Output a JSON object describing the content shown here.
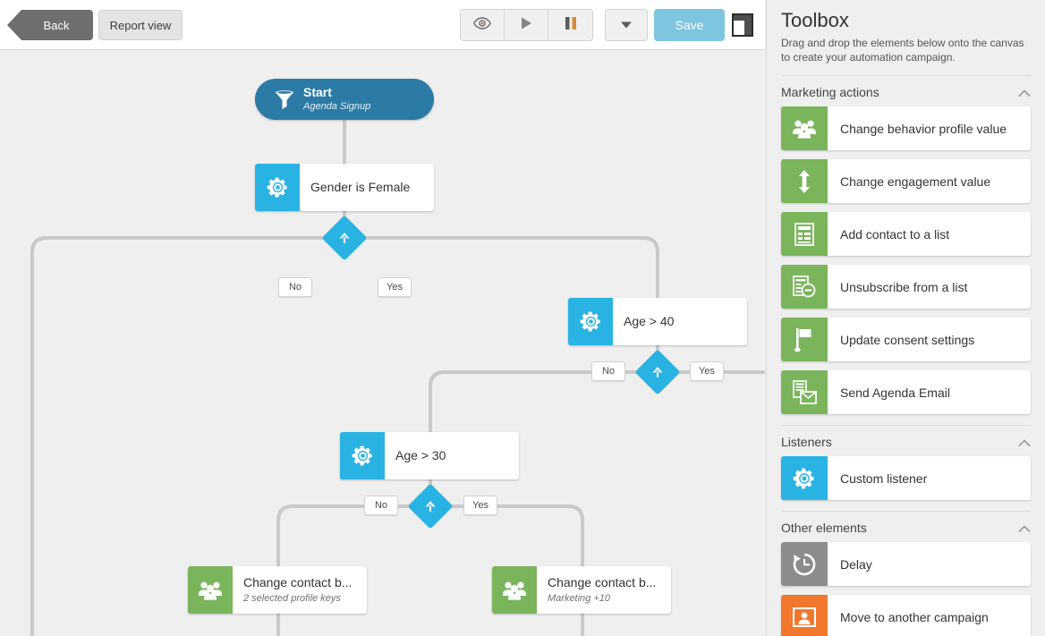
{
  "toolbar": {
    "back_label": "Back",
    "report_label": "Report view",
    "preview_icon": "eye-icon",
    "play_icon": "play-icon",
    "pause_icon": "pause-icon",
    "dropdown_icon": "chevron-down-icon",
    "save_label": "Save",
    "panel_toggle_icon": "panel-layout-icon"
  },
  "toolbox": {
    "title": "Toolbox",
    "description": "Drag and drop the elements below onto the canvas to create your automation campaign.",
    "sections": [
      {
        "label": "Marketing actions",
        "collapse_icon": "chevron-up-icon",
        "items": [
          {
            "label": "Change behavior profile value",
            "icon": "people-group-icon",
            "color": "green"
          },
          {
            "label": "Change engagement value",
            "icon": "up-down-arrow-icon",
            "color": "green"
          },
          {
            "label": "Add contact to a list",
            "icon": "list-document-icon",
            "color": "green"
          },
          {
            "label": "Unsubscribe from a list",
            "icon": "list-minus-icon",
            "color": "green"
          },
          {
            "label": "Update consent settings",
            "icon": "flag-icon",
            "color": "green"
          },
          {
            "label": "Send Agenda Email",
            "icon": "envelope-document-icon",
            "color": "green"
          }
        ]
      },
      {
        "label": "Listeners",
        "collapse_icon": "chevron-up-icon",
        "items": [
          {
            "label": "Custom listener",
            "icon": "gear-icon",
            "color": "blue"
          }
        ]
      },
      {
        "label": "Other elements",
        "collapse_icon": "chevron-up-icon",
        "items": [
          {
            "label": "Delay",
            "icon": "clock-rewind-icon",
            "color": "grey"
          },
          {
            "label": "Move to another campaign",
            "icon": "contact-portrait-icon",
            "color": "orange"
          }
        ]
      }
    ]
  },
  "canvas": {
    "start": {
      "title": "Start",
      "subtitle": "Agenda Signup",
      "icon": "funnel-icon"
    },
    "nodes": [
      {
        "title": "Gender is Female",
        "subtitle": "",
        "icon": "gear-icon",
        "color": "blue"
      },
      {
        "title": "Age > 40",
        "subtitle": "",
        "icon": "gear-icon",
        "color": "blue"
      },
      {
        "title": "Age > 30",
        "subtitle": "",
        "icon": "gear-icon",
        "color": "blue"
      },
      {
        "title": "Change contact b...",
        "subtitle": "2 selected profile keys",
        "icon": "people-group-icon",
        "color": "green"
      },
      {
        "title": "Change contact b...",
        "subtitle": "Marketing +10",
        "icon": "people-group-icon",
        "color": "green"
      }
    ],
    "branches": {
      "gender_no": "No",
      "gender_yes": "Yes",
      "age40_no": "No",
      "age40_yes": "Yes",
      "age30_no": "No",
      "age30_yes": "Yes"
    },
    "decision_icon": "split-fork-icon"
  },
  "colors": {
    "accent_blue": "#29b3e3",
    "start_blue": "#2c7ba6",
    "save_blue": "#7ec5e0",
    "green": "#7ab55c",
    "grey": "#8c8c8c",
    "orange": "#f0772c",
    "edge": "#c8c8c8"
  }
}
